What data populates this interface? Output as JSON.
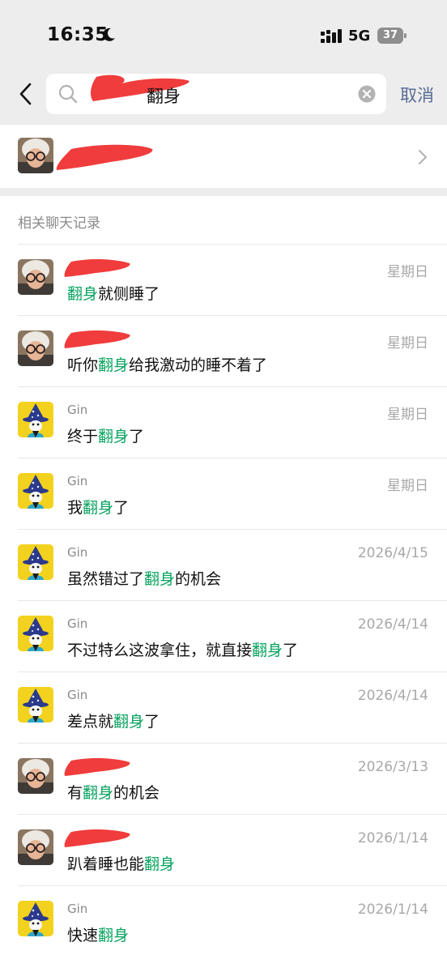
{
  "status_bar": {
    "time": "16:35",
    "network": "5G",
    "battery": "37",
    "icons": [
      "moon-icon",
      "signal-icon",
      "battery-icon"
    ]
  },
  "header": {
    "back_icon": "chevron-left-icon",
    "search": {
      "query": "翻身",
      "icon": "search-icon",
      "clear_icon": "clear-icon"
    },
    "cancel_label": "取消"
  },
  "contact": {
    "chevron_icon": "chevron-right-icon"
  },
  "records": {
    "section_title": "相关聊天记录",
    "keyword": "翻身",
    "items": [
      {
        "sender": "",
        "avatar": "old-lady",
        "date": "星期日",
        "msg_before": "",
        "msg_keyword": "翻身",
        "msg_after": "就侧睡了"
      },
      {
        "sender": "",
        "avatar": "old-lady",
        "date": "星期日",
        "msg_before": "听你",
        "msg_keyword": "翻身",
        "msg_after": "给我激动的睡不着了"
      },
      {
        "sender": "Gin",
        "avatar": "wizard",
        "date": "星期日",
        "msg_before": "终于",
        "msg_keyword": "翻身",
        "msg_after": "了"
      },
      {
        "sender": "Gin",
        "avatar": "wizard",
        "date": "星期日",
        "msg_before": "我",
        "msg_keyword": "翻身",
        "msg_after": "了"
      },
      {
        "sender": "Gin",
        "avatar": "wizard",
        "date": "2026/4/15",
        "msg_before": "虽然错过了",
        "msg_keyword": "翻身",
        "msg_after": "的机会"
      },
      {
        "sender": "Gin",
        "avatar": "wizard",
        "date": "2026/4/14",
        "msg_before": "不过特么这波拿住，就直接",
        "msg_keyword": "翻身",
        "msg_after": "了"
      },
      {
        "sender": "Gin",
        "avatar": "wizard",
        "date": "2026/4/14",
        "msg_before": "差点就",
        "msg_keyword": "翻身",
        "msg_after": "了"
      },
      {
        "sender": "",
        "avatar": "old-lady",
        "date": "2026/3/13",
        "msg_before": "有",
        "msg_keyword": "翻身",
        "msg_after": "的机会"
      },
      {
        "sender": "",
        "avatar": "old-lady",
        "date": "2026/1/14",
        "msg_before": "趴着睡也能",
        "msg_keyword": "翻身",
        "msg_after": ""
      },
      {
        "sender": "Gin",
        "avatar": "wizard",
        "date": "2026/1/14",
        "msg_before": "快速",
        "msg_keyword": "翻身",
        "msg_after": ""
      }
    ]
  },
  "colors": {
    "background": "#ededed",
    "highlight": "#07a35e",
    "cancel_link": "#576b95",
    "secondary_text": "#8a8a8a",
    "redaction": "#f03c3c"
  }
}
